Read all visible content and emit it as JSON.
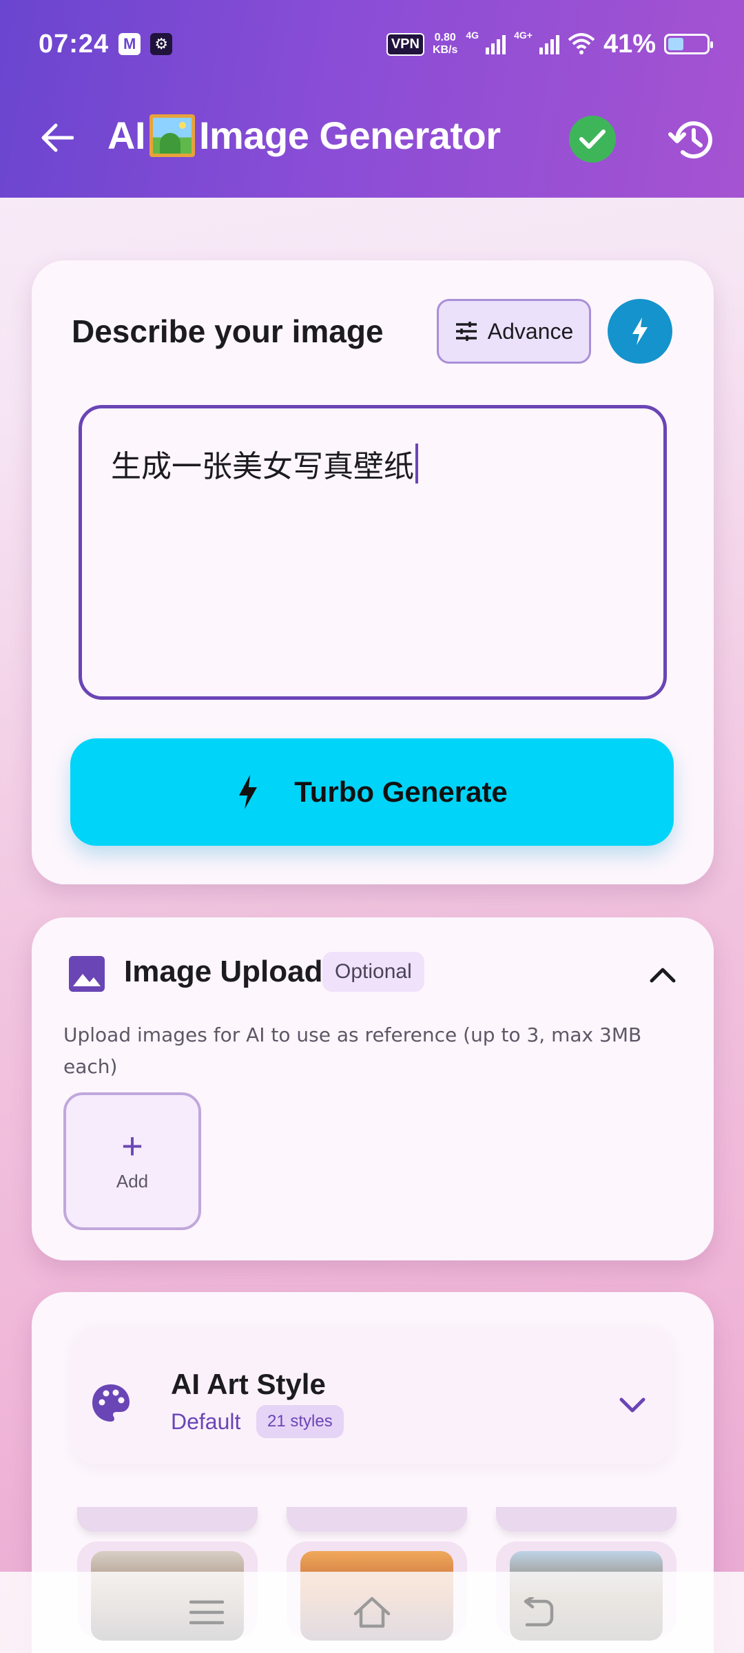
{
  "status_bar": {
    "time": "07:24",
    "vpn": "VPN",
    "speed_value": "0.80",
    "speed_unit": "KB/s",
    "net1": "4G",
    "net2": "4G+",
    "battery": "41%",
    "battery_level": 0.41,
    "icons": [
      "gmail-icon",
      "game-icon",
      "wifi-icon",
      "signal-icon",
      "battery-icon"
    ]
  },
  "app_bar": {
    "title_prefix": "AI",
    "title_suffix": "Image Generator",
    "back_icon": "arrow-left-icon",
    "check_icon": "check-circle-icon",
    "history_icon": "history-icon",
    "check_color": "#3fb55a"
  },
  "prompt_card": {
    "heading": "Describe your image",
    "advance_label": "Advance",
    "prompt_value": "生成一张美女写真壁纸",
    "generate_label": "Turbo Generate",
    "generate_color": "#00d4f8",
    "accent_color": "#6a45b5"
  },
  "upload_card": {
    "title": "Image Upload",
    "badge": "Optional",
    "description": "Upload images for AI to use as reference (up to 3, max 3MB each)",
    "add_label": "Add"
  },
  "style_card": {
    "title": "AI Art Style",
    "selected": "Default",
    "count": "21 styles"
  },
  "nav_bar": {
    "icons": [
      "menu-icon",
      "home-icon",
      "back-icon"
    ]
  }
}
